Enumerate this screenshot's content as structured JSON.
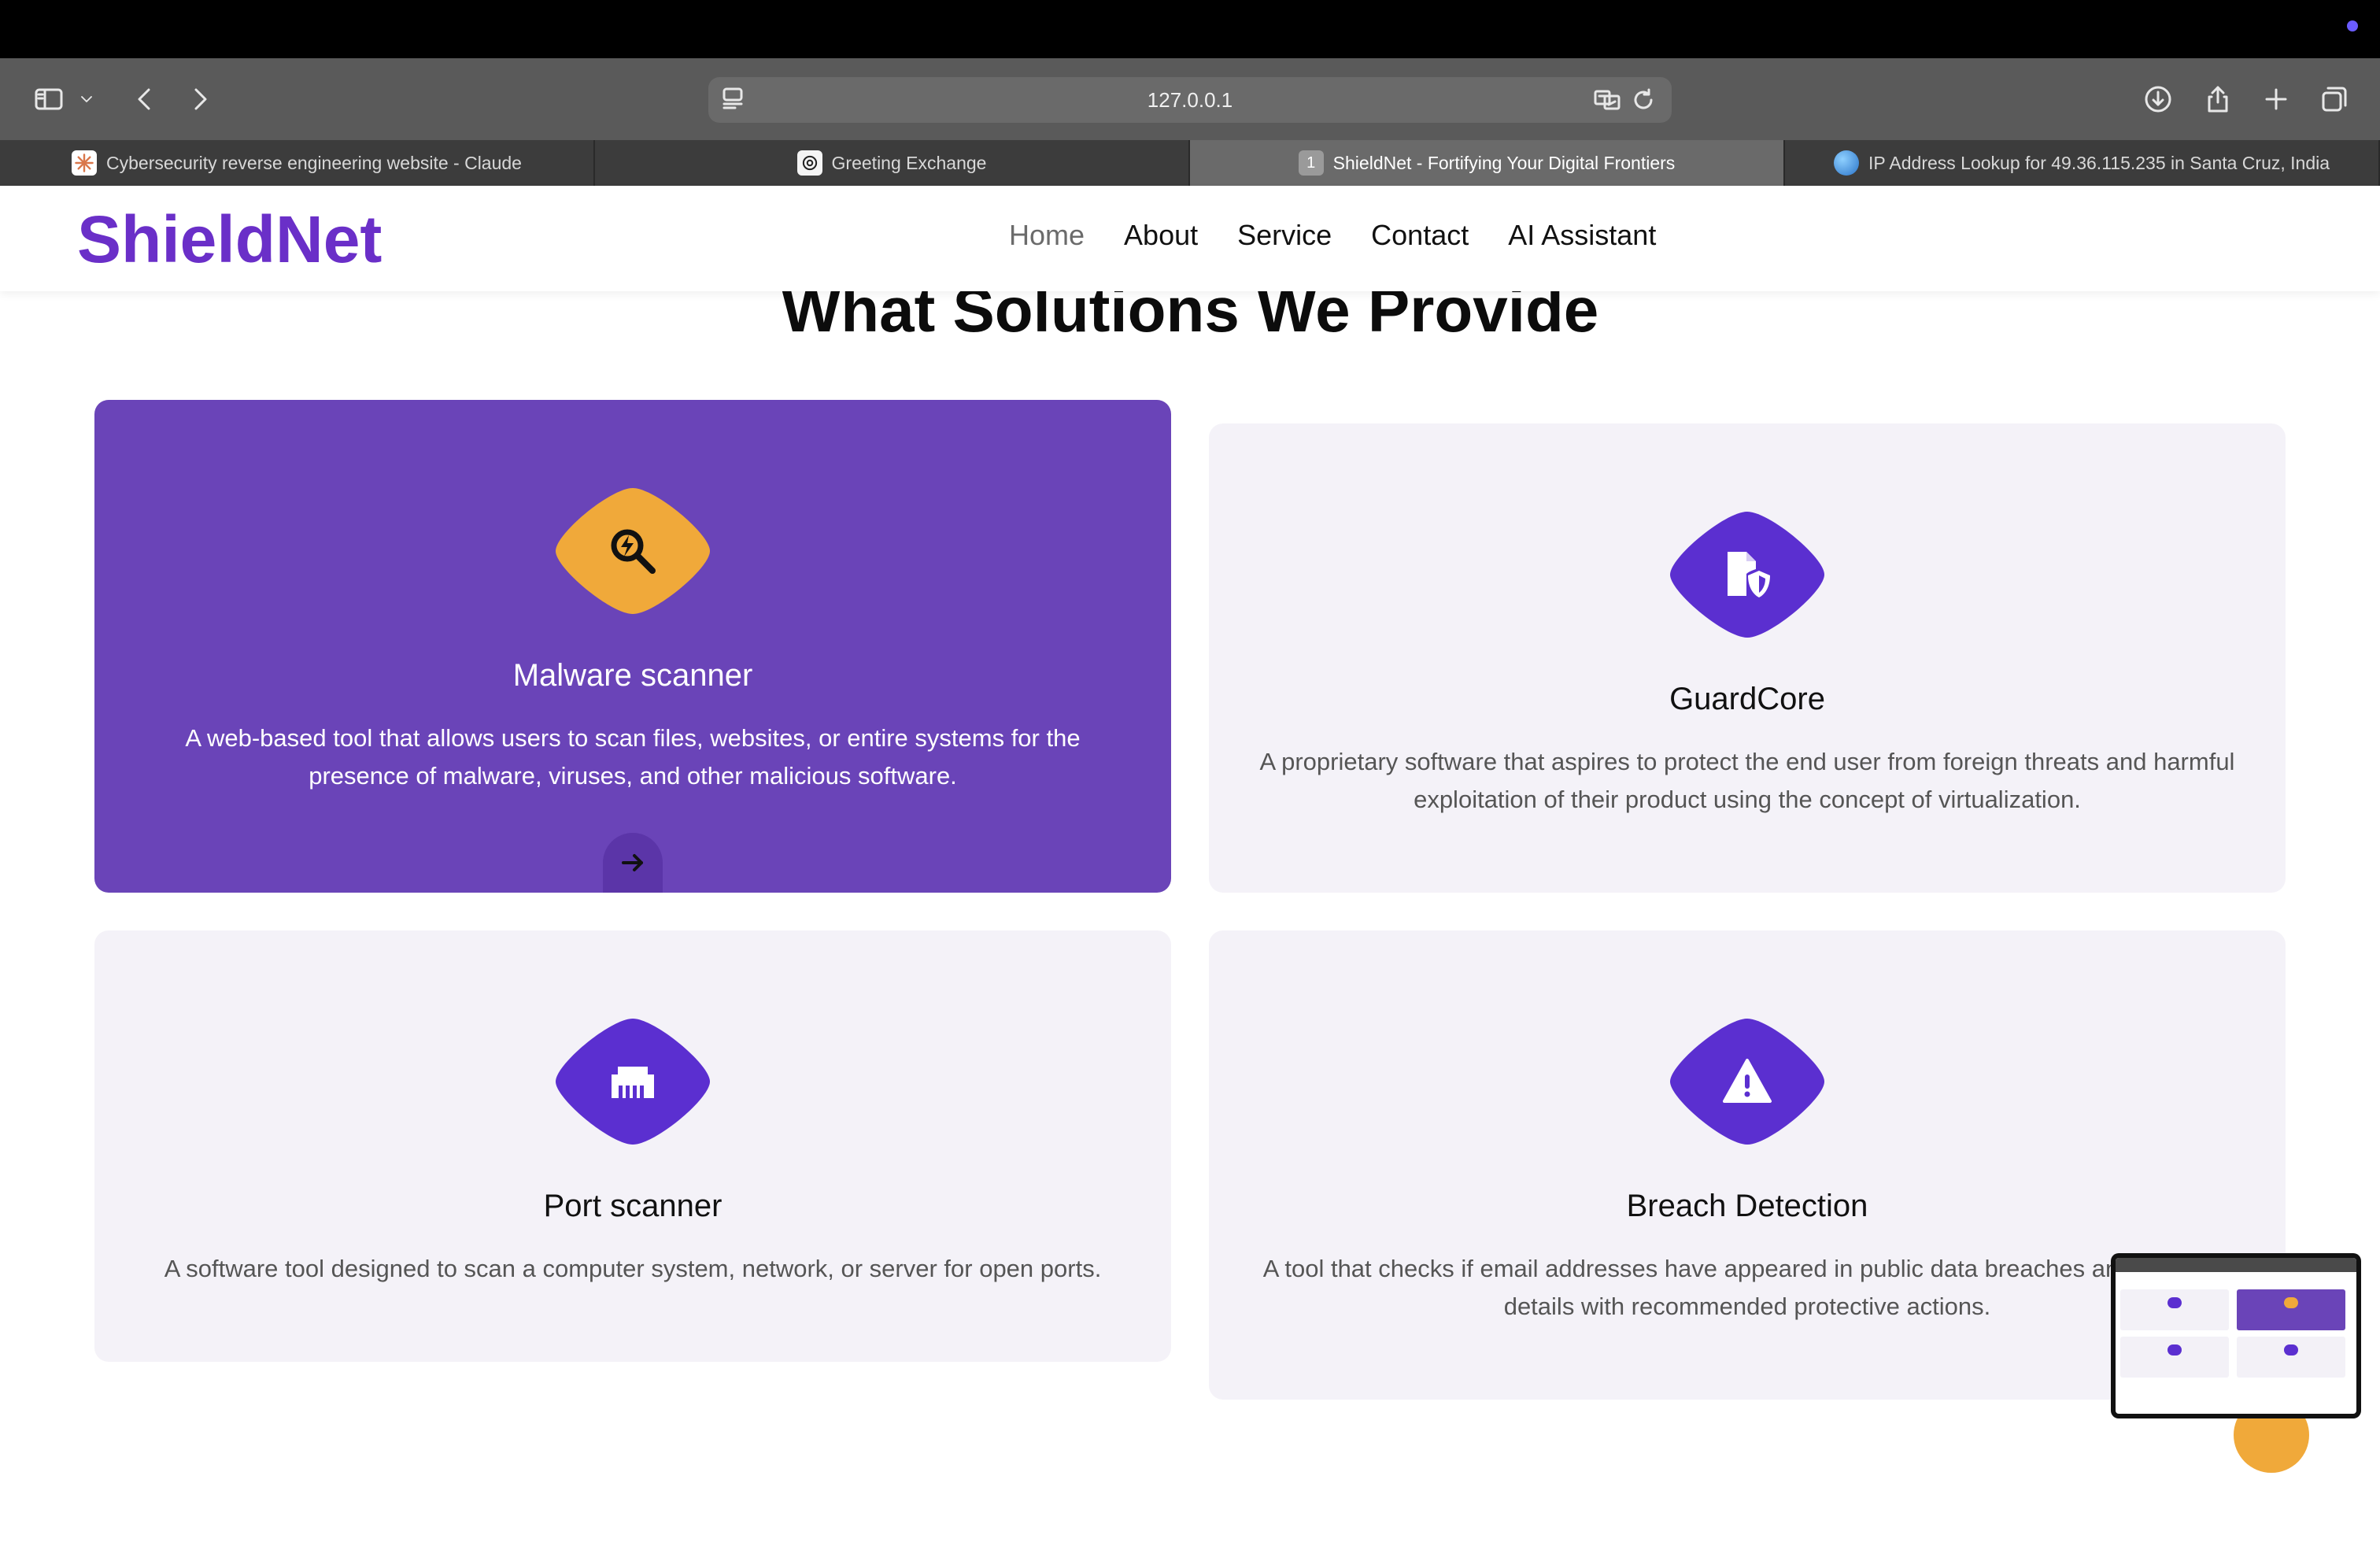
{
  "browser": {
    "url": "127.0.0.1",
    "tabs": [
      {
        "title": "Cybersecurity reverse engineering website - Claude",
        "icon": "claude-icon"
      },
      {
        "title": "Greeting Exchange",
        "icon": "chatgpt-icon"
      },
      {
        "title": "ShieldNet - Fortifying Your Digital Frontiers",
        "icon": "tab-number-icon",
        "badge": "1",
        "active": true
      },
      {
        "title": "IP Address Lookup for 49.36.115.235 in Santa Cruz, India",
        "icon": "globe-icon"
      }
    ]
  },
  "site": {
    "logo": "ShieldNet",
    "nav": [
      "Home",
      "About",
      "Service",
      "Contact",
      "AI Assistant"
    ]
  },
  "section": {
    "title": "What Solutions We Provide"
  },
  "cards": [
    {
      "title": "Malware scanner",
      "description": "A web-based tool that allows users to scan files, websites, or entire systems for the presence of malware, viruses, and other malicious software.",
      "icon": "malware-search-icon"
    },
    {
      "title": "GuardCore",
      "description": "A proprietary software that aspires to protect the end user from foreign threats and harmful exploitation of their product using the concept of virtualization.",
      "icon": "file-shield-icon"
    },
    {
      "title": "Port scanner",
      "description": "A software tool designed to scan a computer system, network, or server for open ports.",
      "icon": "ethernet-port-icon"
    },
    {
      "title": "Breach Detection",
      "description": "A tool that checks if email addresses have appeared in public data breaches and provides details with recommended protective actions.",
      "icon": "warning-triangle-icon"
    }
  ],
  "colors": {
    "brand": "#6a2fc8",
    "featured_card": "#6a44b8",
    "icon_purple": "#5b2fd0",
    "icon_orange": "#f0a93a",
    "card_bg": "#f4f2f8"
  }
}
